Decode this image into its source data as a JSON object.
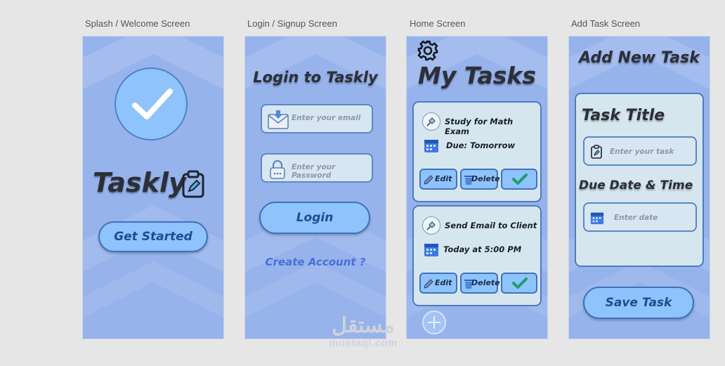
{
  "labels": {
    "splash": "Splash / Welcome Screen",
    "login": "Login / Signup Screen",
    "home": "Home Screen",
    "add": "Add Task Screen"
  },
  "splash": {
    "app_name": "Taskly",
    "cta": "Get Started",
    "icons": [
      "check-icon",
      "clipboard-icon"
    ]
  },
  "login": {
    "title": "Login to Taskly",
    "email_placeholder": "Enter your email",
    "password_placeholder": "Enter your Password",
    "login_button": "Login",
    "create_account": "Create Account ?",
    "icons": [
      "envelope-icon",
      "lock-icon"
    ]
  },
  "home": {
    "title": "My Tasks",
    "tasks": [
      {
        "title": "Study for Math Exam",
        "due": "Due: Tomorrow"
      },
      {
        "title": "Send Email to Client",
        "due": "Today at 5:00 PM"
      }
    ],
    "edit_label": "Edit",
    "delete_label": "Delete",
    "icons": [
      "gear-icon",
      "pin-icon",
      "calendar-icon",
      "pencil-icon",
      "trash-icon",
      "check-icon",
      "plus-icon"
    ]
  },
  "add": {
    "title": "Add New Task",
    "task_title_label": "Task Title",
    "task_placeholder": "Enter your task",
    "due_label": "Due Date & Time",
    "date_placeholder": "Enter date",
    "save_button": "Save Task"
  },
  "watermark": {
    "arabic": "مستقل",
    "latin": "mostaql.com"
  },
  "colors": {
    "frame_bg": "#97b3ec",
    "button_fill": "#8ec3fb",
    "button_border": "#3f72bd",
    "card_bg": "#d6e6ee",
    "link": "#4a6fd6",
    "check_green": "#1f9d6a"
  }
}
